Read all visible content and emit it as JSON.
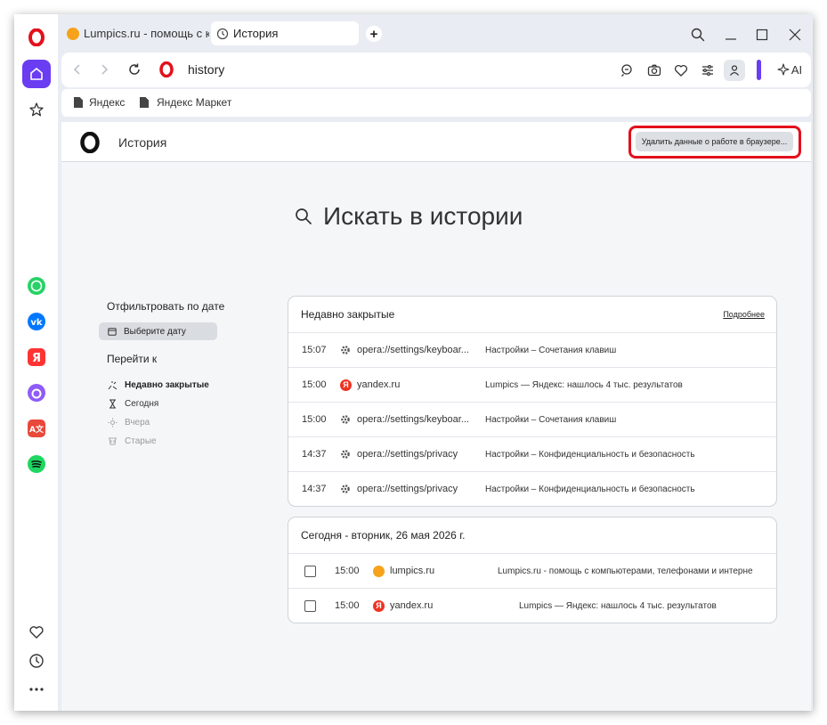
{
  "tabs": [
    {
      "title": "Lumpics.ru - помощь с компьютерами",
      "active": false
    },
    {
      "title": "История",
      "active": true
    }
  ],
  "address": {
    "url": "history"
  },
  "ai_label": "AI",
  "bookmarks": [
    {
      "label": "Яндекс"
    },
    {
      "label": "Яндекс Маркет"
    }
  ],
  "header": {
    "title": "История",
    "clear_button": "Удалить данные о работе в браузере..."
  },
  "search": {
    "placeholder": "Искать в истории"
  },
  "filters": {
    "filter_title": "Отфильтровать по дате",
    "date_button": "Выберите дату",
    "goto_title": "Перейти к",
    "links": [
      {
        "label": "Недавно закрытые",
        "active": true
      },
      {
        "label": "Сегодня",
        "active": false
      },
      {
        "label": "Вчера",
        "active": false
      },
      {
        "label": "Старые",
        "active": false
      }
    ]
  },
  "recently_closed": {
    "title": "Недавно закрытые",
    "more_link": "Подробнее",
    "rows": [
      {
        "time": "15:07",
        "icon": "gear-icon",
        "url": "opera://settings/keyboar...",
        "title": "Настройки – Сочетания клавиш"
      },
      {
        "time": "15:00",
        "icon": "yandex-icon",
        "url": "yandex.ru",
        "title": "Lumpics — Яндекс: нашлось 4 тыс. результатов"
      },
      {
        "time": "15:00",
        "icon": "gear-icon",
        "url": "opera://settings/keyboar...",
        "title": "Настройки – Сочетания клавиш"
      },
      {
        "time": "14:37",
        "icon": "gear-icon",
        "url": "opera://settings/privacy",
        "title": "Настройки – Конфиденциальность и безопасность"
      },
      {
        "time": "14:37",
        "icon": "gear-icon",
        "url": "opera://settings/privacy",
        "title": "Настройки – Конфиденциальность и безопасность"
      }
    ]
  },
  "today": {
    "title": "Сегодня - вторник, 26 мая 2026 г.",
    "rows": [
      {
        "time": "15:00",
        "icon": "lumpics-icon",
        "url": "lumpics.ru",
        "title": "Lumpics.ru - помощь с компьютерами, телефонами и интерне"
      },
      {
        "time": "15:00",
        "icon": "yandex-icon",
        "url": "yandex.ru",
        "title": "Lumpics — Яндекс: нашлось 4 тыс. результатов"
      }
    ]
  },
  "colors": {
    "accent": "#6a3df2",
    "highlight": "#e3101c",
    "opera_red": "#e3101c"
  }
}
